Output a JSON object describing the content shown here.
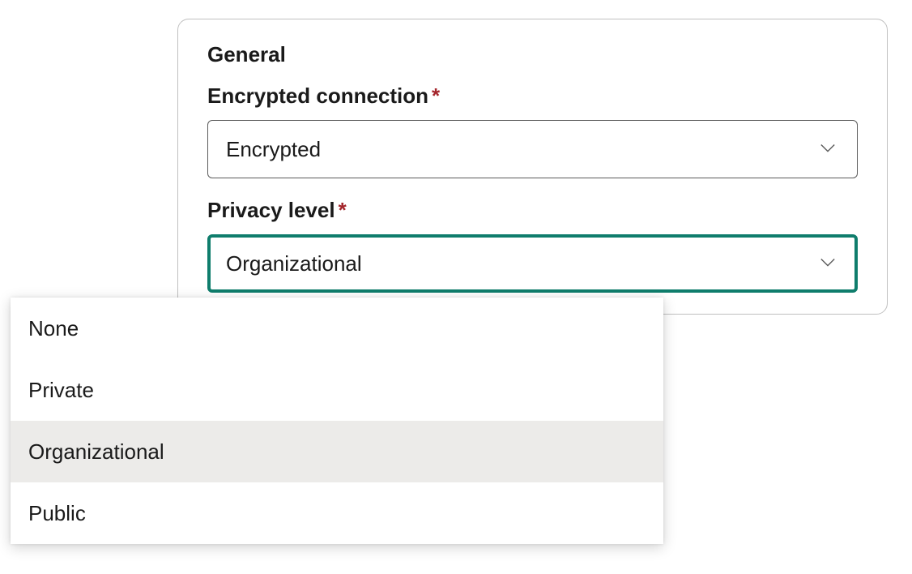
{
  "panel": {
    "title": "General",
    "fields": {
      "encrypted": {
        "label": "Encrypted connection",
        "required_marker": "*",
        "value": "Encrypted"
      },
      "privacy": {
        "label": "Privacy level",
        "required_marker": "*",
        "value": "Organizational",
        "options": [
          "None",
          "Private",
          "Organizational",
          "Public"
        ]
      }
    }
  },
  "colors": {
    "accent": "#0f7d6c",
    "required": "#a4262c",
    "border": "#5b5b5b",
    "panel_border": "#c0c0c0",
    "selected_bg": "#ecebe9"
  }
}
